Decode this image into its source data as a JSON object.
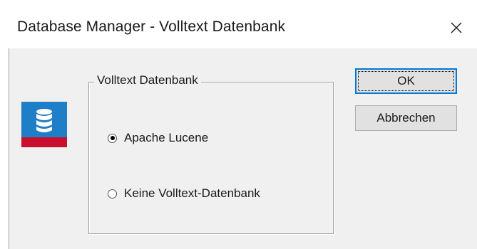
{
  "window": {
    "title": "Database Manager - Volltext Datenbank",
    "close_icon": "close-icon"
  },
  "app_icon": {
    "name": "database-icon",
    "colors": {
      "top": "#1e7ec8",
      "bottom": "#c8102e",
      "glyph": "#ffffff"
    }
  },
  "group": {
    "legend": "Volltext Datenbank",
    "options": [
      {
        "label": "Apache Lucene",
        "selected": true
      },
      {
        "label": "Keine Volltext-Datenbank",
        "selected": false
      }
    ]
  },
  "buttons": {
    "ok_label": "OK",
    "cancel_label": "Abbrechen"
  },
  "colors": {
    "focus_accent": "#0078d7",
    "client_bg": "#f0f0f0"
  }
}
